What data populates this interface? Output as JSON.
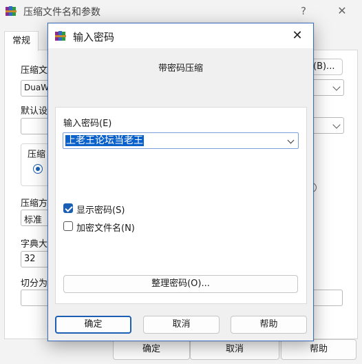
{
  "background_window": {
    "title": "压缩文件名和参数",
    "help_glyph": "?",
    "close_glyph": "✕",
    "tab_general": "常规",
    "archive_label": "压缩文",
    "archive_value": "DuaWe",
    "browse_button": "(B)...",
    "default_label": "默认设",
    "format_label": "压缩",
    "method_label": "压缩方",
    "method_value": "标准",
    "dict_label": "字典大",
    "dict_value": "32",
    "split_label": "切分为",
    "ok_button": "确定",
    "cancel_button": "取消",
    "help_button": "帮助"
  },
  "dialog": {
    "title": "输入密码",
    "close_glyph": "✕",
    "subtitle": "带密码压缩",
    "password_label": "输入密码(E)",
    "password_value": "上老王论坛当老王",
    "show_password_label": "显示密码(S)",
    "show_password_checked": true,
    "encrypt_names_label": "加密文件名(N)",
    "encrypt_names_checked": false,
    "organize_button": "整理密码(O)...",
    "ok_button": "确定",
    "cancel_button": "取消",
    "help_button": "帮助"
  },
  "icons": {
    "app": "winrar-books-icon",
    "dropdown": "chevron-down-icon",
    "close": "close-icon"
  },
  "colors": {
    "accent": "#1a5fb4",
    "selection": "#0a61c9",
    "dialog_border": "#3c6fbf"
  }
}
